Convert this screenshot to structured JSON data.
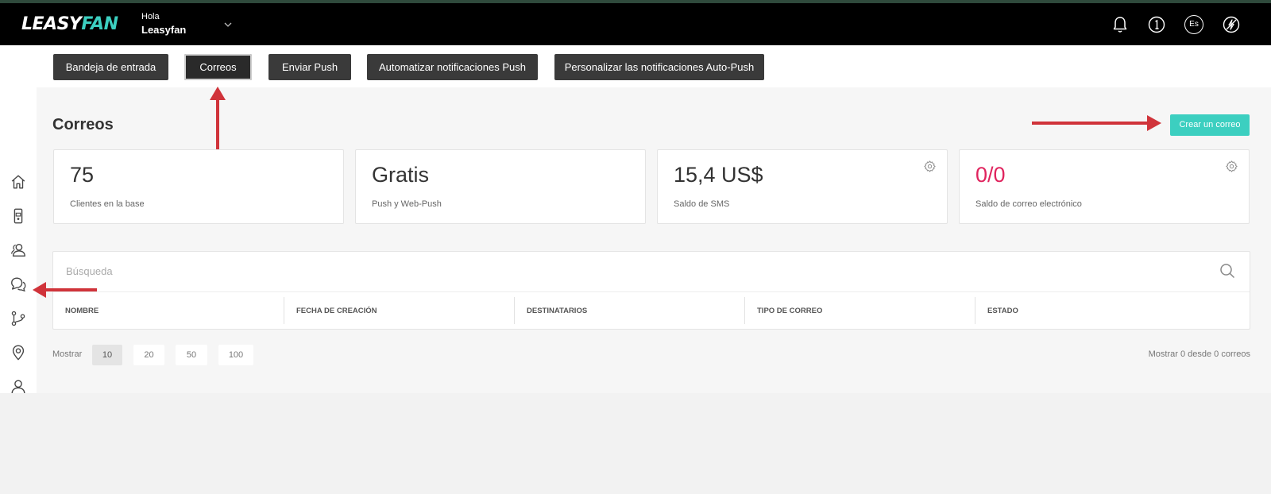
{
  "brand": {
    "logo_part1": "LEASY",
    "logo_part2": "FAN"
  },
  "header": {
    "greeting": "Hola",
    "username": "Leasyfan",
    "icons": [
      "bell-icon",
      "info-icon",
      "language-icon",
      "no-flash-icon"
    ],
    "language_code": "Es"
  },
  "tabs": [
    {
      "label": "Bandeja de entrada",
      "active": false
    },
    {
      "label": "Correos",
      "active": true
    },
    {
      "label": "Enviar Push",
      "active": false
    },
    {
      "label": "Automatizar notificaciones Push",
      "active": false
    },
    {
      "label": "Personalizar las notificaciones Auto-Push",
      "active": false
    }
  ],
  "sidebar": {
    "items": [
      "home-icon",
      "mobile-card-icon",
      "users-icon",
      "chat-icon",
      "branch-icon",
      "location-pin-icon",
      "person-icon"
    ]
  },
  "page": {
    "title": "Correos",
    "create_button": "Crear un correo"
  },
  "stats": [
    {
      "value": "75",
      "caption": "Clientes en la base",
      "settings": false
    },
    {
      "value": "Gratis",
      "caption": "Push y Web-Push",
      "settings": false
    },
    {
      "value": "15,4 US$",
      "caption": "Saldo de SMS",
      "settings": true
    },
    {
      "value": "0/0",
      "caption": "Saldo de correo electrónico",
      "settings": true
    }
  ],
  "search": {
    "placeholder": "Búsqueda",
    "value": ""
  },
  "table": {
    "columns": [
      "NOMBRE",
      "FECHA DE CREACIÓN",
      "DESTINATARIOS",
      "TIPO DE CORREO",
      "ESTADO"
    ],
    "rows": []
  },
  "pagination": {
    "show_label": "Mostrar",
    "sizes": [
      "10",
      "20",
      "50",
      "100"
    ],
    "selected": "10",
    "count_text": "Mostrar 0 desde 0 correos"
  },
  "colors": {
    "accent": "#3ccfc0",
    "topbar": "#000000",
    "tab_button": "#3a3a3a",
    "negative_value": "#e0245e",
    "annotation_arrow": "#d0333a"
  }
}
